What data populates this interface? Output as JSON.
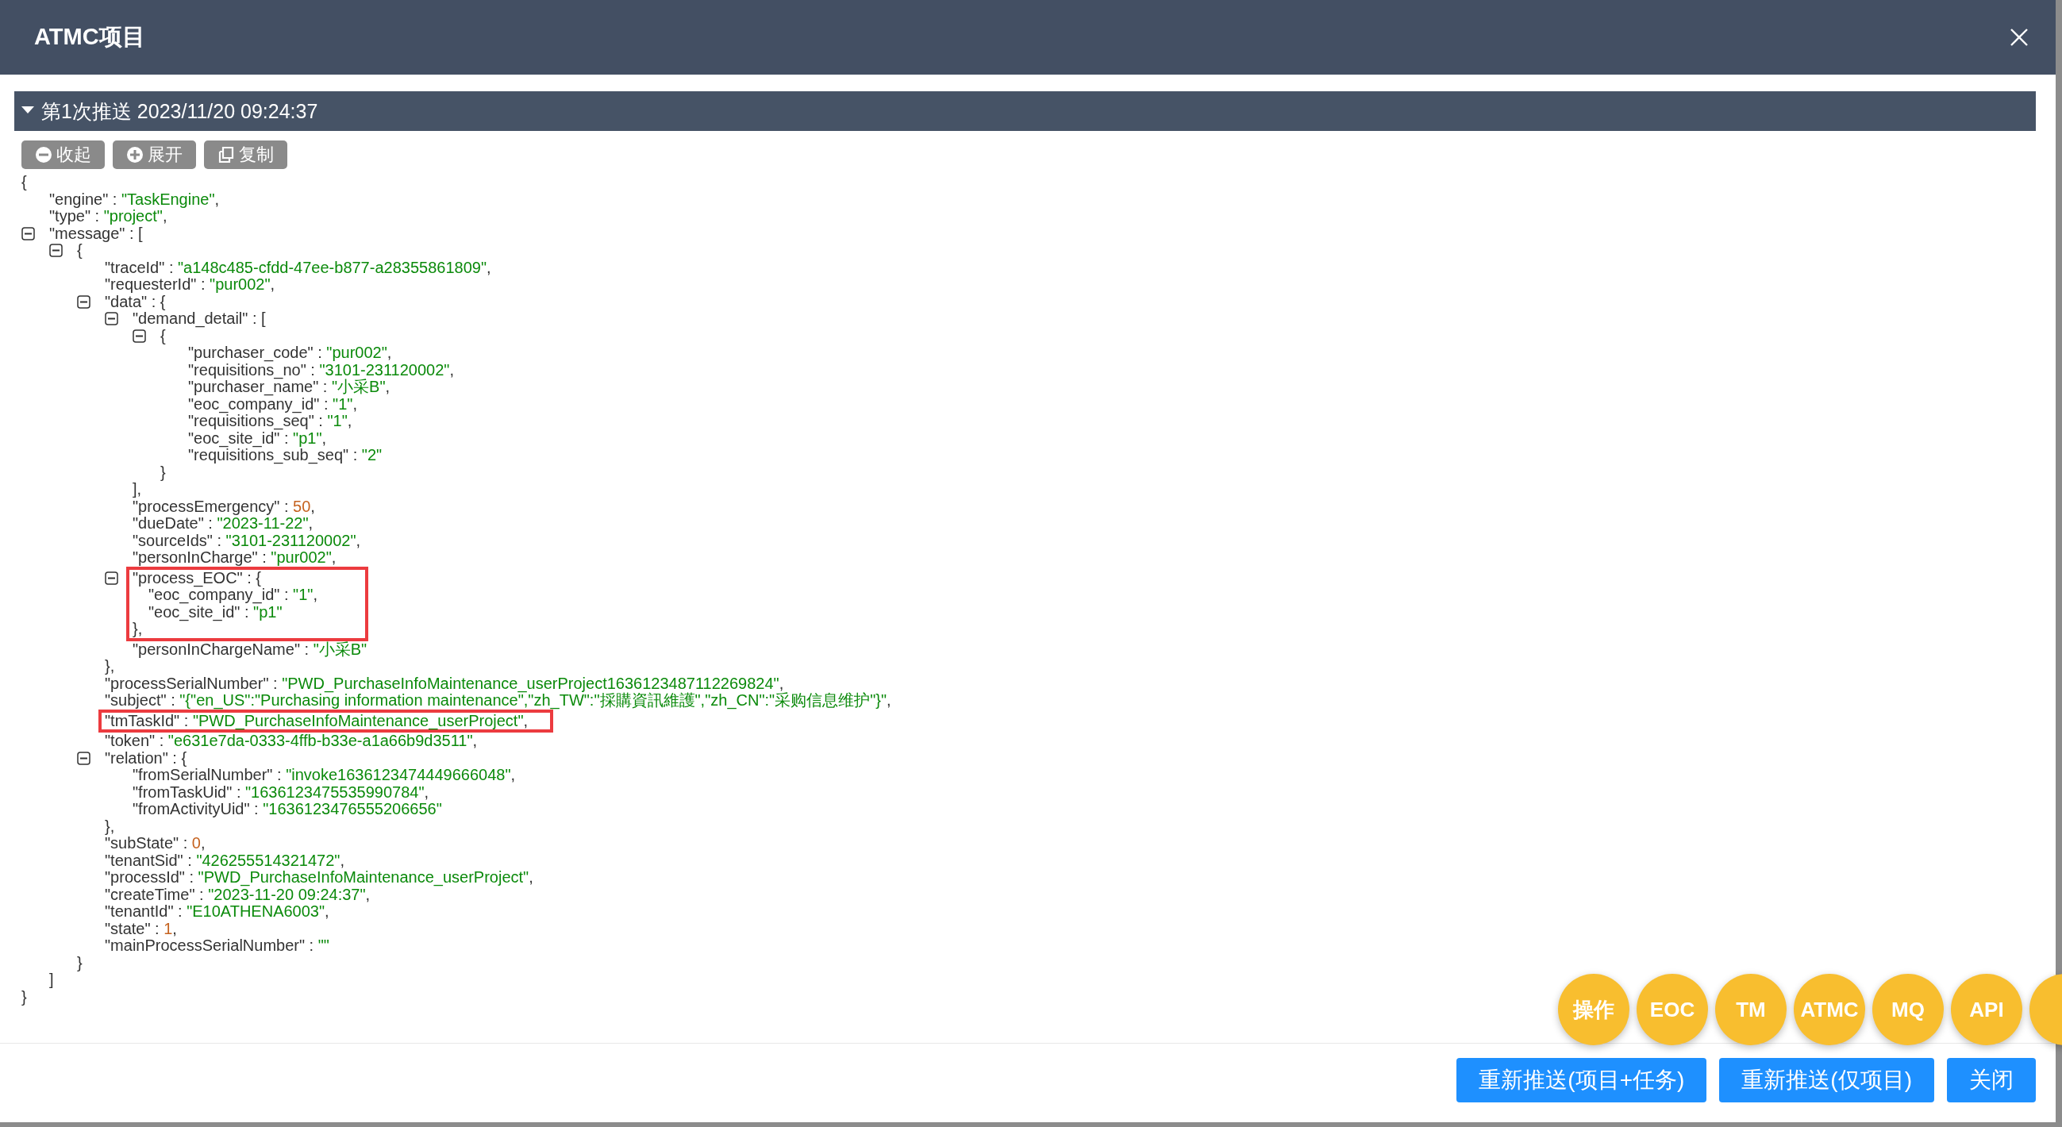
{
  "header": {
    "title": "ATMC项目"
  },
  "section": {
    "title": "第1次推送 2023/11/20 09:24:37",
    "expanded": true
  },
  "toolbar": [
    {
      "kind": "collapse",
      "label": "收起"
    },
    {
      "kind": "expand",
      "label": "展开"
    },
    {
      "kind": "copy",
      "label": "复制"
    }
  ],
  "tree": {
    "open": "{",
    "close": "}",
    "children": [
      {
        "key": "\"engine\" : ",
        "value": "\"TaskEngine\"",
        "kind": "string",
        "tail": ","
      },
      {
        "key": "\"type\" : ",
        "value": "\"project\"",
        "kind": "string",
        "tail": ","
      },
      {
        "key": "\"message\" : ",
        "open": "[",
        "expanded": true,
        "close": "]",
        "children": [
          {
            "open": "{",
            "expanded": true,
            "close": "}",
            "children": [
              {
                "key": "\"traceId\" : ",
                "value": "\"a148c485-cfdd-47ee-b877-a28355861809\"",
                "kind": "string",
                "tail": ","
              },
              {
                "key": "\"requesterId\" : ",
                "value": "\"pur002\"",
                "kind": "string",
                "tail": ","
              },
              {
                "key": "\"data\" : ",
                "open": "{",
                "expanded": true,
                "close": "},",
                "children": [
                  {
                    "key": "\"demand_detail\" : ",
                    "open": "[",
                    "expanded": true,
                    "close": "],",
                    "children": [
                      {
                        "open": "{",
                        "expanded": true,
                        "close": "}",
                        "children": [
                          {
                            "key": "\"purchaser_code\" : ",
                            "value": "\"pur002\"",
                            "kind": "string",
                            "tail": ","
                          },
                          {
                            "key": "\"requisitions_no\" : ",
                            "value": "\"3101-231120002\"",
                            "kind": "string",
                            "tail": ","
                          },
                          {
                            "key": "\"purchaser_name\" : ",
                            "value": "\"小采B\"",
                            "kind": "string",
                            "tail": ","
                          },
                          {
                            "key": "\"eoc_company_id\" : ",
                            "value": "\"1\"",
                            "kind": "string",
                            "tail": ","
                          },
                          {
                            "key": "\"requisitions_seq\" : ",
                            "value": "\"1\"",
                            "kind": "string",
                            "tail": ","
                          },
                          {
                            "key": "\"eoc_site_id\" : ",
                            "value": "\"p1\"",
                            "kind": "string",
                            "tail": ","
                          },
                          {
                            "key": "\"requisitions_sub_seq\" : ",
                            "value": "\"2\"",
                            "kind": "string"
                          }
                        ]
                      }
                    ]
                  },
                  {
                    "key": "\"processEmergency\" : ",
                    "value": "50",
                    "kind": "number",
                    "tail": ","
                  },
                  {
                    "key": "\"dueDate\" : ",
                    "value": "\"2023-11-22\"",
                    "kind": "string",
                    "tail": ","
                  },
                  {
                    "key": "\"sourceIds\" : ",
                    "value": "\"3101-231120002\"",
                    "kind": "string",
                    "tail": ","
                  },
                  {
                    "key": "\"personInCharge\" : ",
                    "value": "\"pur002\"",
                    "kind": "string",
                    "tail": ","
                  },
                  {
                    "key": "\"process_EOC\" : ",
                    "open": "{",
                    "expanded": true,
                    "highlighted": true,
                    "close": "},",
                    "children": [
                      {
                        "key": "\"eoc_company_id\" : ",
                        "value": "\"1\"",
                        "kind": "string",
                        "tail": ","
                      },
                      {
                        "key": "\"eoc_site_id\" : ",
                        "value": "\"p1\"",
                        "kind": "string"
                      }
                    ]
                  },
                  {
                    "key": "\"personInChargeName\" : ",
                    "value": "\"小采B\"",
                    "kind": "string"
                  }
                ]
              },
              {
                "key": "\"processSerialNumber\" : ",
                "value": "\"PWD_PurchaseInfoMaintenance_userProject1636123487112269824\"",
                "kind": "string",
                "tail": ","
              },
              {
                "key": "\"subject\" : ",
                "value": "\"{\"en_US\":\"Purchasing information maintenance\",\"zh_TW\":\"採購資訊維護\",\"zh_CN\":\"采购信息维护\"}\"",
                "kind": "string",
                "tail": ","
              },
              {
                "key": "\"tmTaskId\" : ",
                "value": "\"PWD_PurchaseInfoMaintenance_userProject\"",
                "kind": "string",
                "tail": ",",
                "highlighted": true
              },
              {
                "key": "\"token\" : ",
                "value": "\"e631e7da-0333-4ffb-b33e-a1a66b9d3511\"",
                "kind": "string",
                "tail": ","
              },
              {
                "key": "\"relation\" : ",
                "open": "{",
                "expanded": true,
                "close": "},",
                "children": [
                  {
                    "key": "\"fromSerialNumber\" : ",
                    "value": "\"invoke1636123474449666048\"",
                    "kind": "string",
                    "tail": ","
                  },
                  {
                    "key": "\"fromTaskUid\" : ",
                    "value": "\"1636123475535990784\"",
                    "kind": "string",
                    "tail": ","
                  },
                  {
                    "key": "\"fromActivityUid\" : ",
                    "value": "\"1636123476555206656\"",
                    "kind": "string"
                  }
                ]
              },
              {
                "key": "\"subState\" : ",
                "value": "0",
                "kind": "number",
                "tail": ","
              },
              {
                "key": "\"tenantSid\" : ",
                "value": "\"426255514321472\"",
                "kind": "string",
                "tail": ","
              },
              {
                "key": "\"processId\" : ",
                "value": "\"PWD_PurchaseInfoMaintenance_userProject\"",
                "kind": "string",
                "tail": ","
              },
              {
                "key": "\"createTime\" : ",
                "value": "\"2023-11-20 09:24:37\"",
                "kind": "string",
                "tail": ","
              },
              {
                "key": "\"tenantId\" : ",
                "value": "\"E10ATHENA6003\"",
                "kind": "string",
                "tail": ","
              },
              {
                "key": "\"state\" : ",
                "value": "1",
                "kind": "number",
                "tail": ","
              },
              {
                "key": "\"mainProcessSerialNumber\" : ",
                "value": "\"\"",
                "kind": "string"
              }
            ]
          }
        ]
      }
    ]
  },
  "footer": {
    "buttons": [
      {
        "label": "重新推送(项目+任务)"
      },
      {
        "label": "重新推送(仅项目)"
      },
      {
        "label": "关闭"
      }
    ]
  },
  "floating_buttons": [
    {
      "kind": "labeled",
      "label": "操作"
    },
    {
      "kind": "labeled",
      "label": "EOC"
    },
    {
      "kind": "labeled",
      "label": "TM"
    },
    {
      "kind": "labeled",
      "label": "ATMC"
    },
    {
      "kind": "labeled",
      "label": "MQ"
    },
    {
      "kind": "labeled",
      "label": "API"
    },
    {
      "kind": "cut"
    }
  ]
}
